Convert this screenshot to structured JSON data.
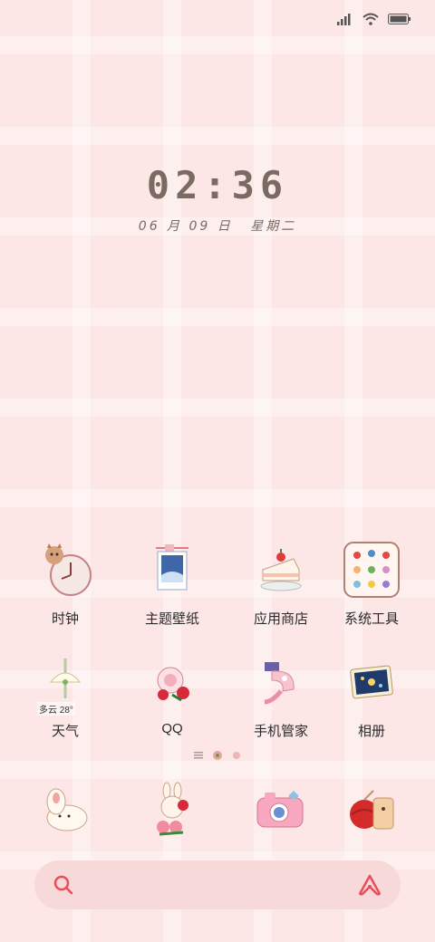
{
  "status": {
    "battery": "full"
  },
  "clock": {
    "time": "02:36",
    "date": "06 月 09 日",
    "weekday": "星期二"
  },
  "apps_row1": [
    {
      "label": "时钟",
      "icon": "clock-icon"
    },
    {
      "label": "主题壁纸",
      "icon": "theme-wallpaper-icon"
    },
    {
      "label": "应用商店",
      "icon": "app-store-icon"
    },
    {
      "label": "系统工具",
      "icon": "system-tools-folder-icon"
    }
  ],
  "apps_row2": [
    {
      "label": "天气",
      "icon": "weather-icon",
      "widget_text": "多云 28°"
    },
    {
      "label": "QQ",
      "icon": "qq-icon"
    },
    {
      "label": "手机管家",
      "icon": "phone-manager-icon"
    },
    {
      "label": "相册",
      "icon": "gallery-icon"
    }
  ],
  "dock": [
    {
      "icon": "phone-icon"
    },
    {
      "icon": "messages-icon"
    },
    {
      "icon": "camera-icon"
    },
    {
      "icon": "browser-icon"
    }
  ],
  "search": {
    "icon": "search-icon",
    "assistant_icon": "assistant-icon"
  },
  "colors": {
    "background": "#fde6e6",
    "accent": "#e84d5a",
    "text": "#7a6b62"
  }
}
